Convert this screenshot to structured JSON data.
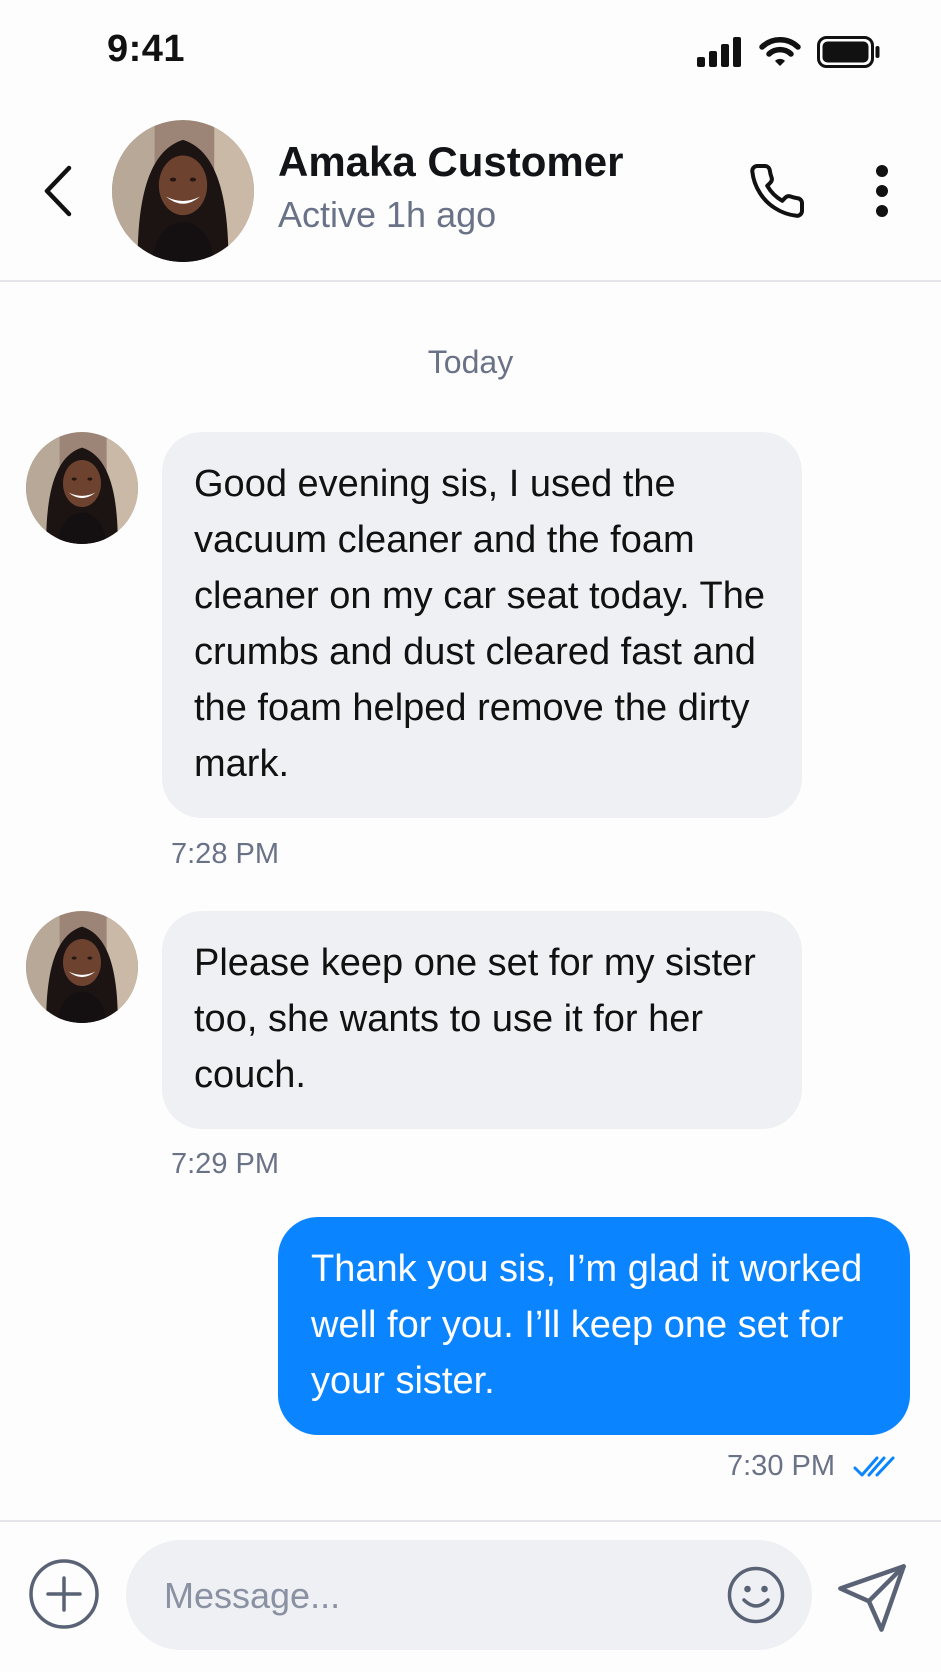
{
  "status_bar": {
    "time": "9:41",
    "icons": [
      "cellular-signal-icon",
      "wifi-icon",
      "battery-icon"
    ]
  },
  "header": {
    "contact_name": "Amaka Customer",
    "contact_status": "Active 1h ago",
    "icons": [
      "back-chevron-icon",
      "phone-icon",
      "more-vertical-icon"
    ]
  },
  "conversation": {
    "date_label": "Today",
    "messages": [
      {
        "direction": "incoming",
        "text": "Good evening sis, I used the vacuum cleaner and the foam cleaner on my car seat today. The crumbs and dust cleared fast and the foam helped remove the dirty mark.",
        "time": "7:28 PM"
      },
      {
        "direction": "incoming",
        "text": "Please keep one set for my sister too, she wants to use it for her couch.",
        "time": "7:29 PM"
      },
      {
        "direction": "outgoing",
        "text": "Thank you sis, I’m glad it worked well for you. I’ll keep one set for your sister.",
        "time": "7:30 PM",
        "read_receipt": "double-check-icon"
      }
    ]
  },
  "composer": {
    "placeholder": "Message...",
    "value": "",
    "icons": [
      "plus-circle-icon",
      "emoji-icon",
      "send-icon"
    ]
  },
  "colors": {
    "accent": "#0a84ff",
    "incoming_bubble": "#eef0f4",
    "secondary_text": "#6a7287",
    "divider": "#e3e5ea"
  }
}
